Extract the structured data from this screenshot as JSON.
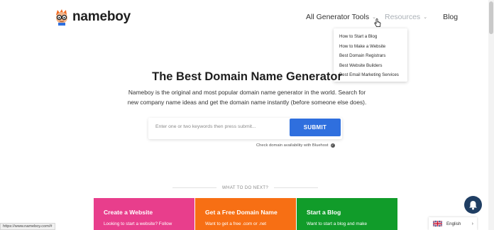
{
  "header": {
    "logo_text_bold": "name",
    "logo_text_rest": "boy",
    "nav": {
      "generator_tools": "All Generator Tools",
      "resources": "Resources",
      "blog": "Blog"
    }
  },
  "resources_dropdown": {
    "items": [
      "How to Start a Blog",
      "How to Make a Website",
      "Best Domain Registrars",
      "Best Website Builders",
      "Best Email Marketing Services"
    ]
  },
  "hero": {
    "title": "The Best Domain Name Generator",
    "subtitle": "Nameboy is the original and most popular domain name generator in the world. Search for new company name ideas and get the domain name instantly (before someone else does)."
  },
  "search": {
    "placeholder": "Enter one or two keywords then press submit...",
    "value": "",
    "submit_label": "SUBMIT",
    "availability_note": "Check domain availability with Bluehost"
  },
  "next_section": {
    "label": "WHAT TO DO NEXT?",
    "cards": [
      {
        "title": "Create a Website",
        "text": "Looking to start a website? Follow",
        "color": "#e83e8c"
      },
      {
        "title": "Get a Free Domain Name",
        "text": "Want to get a free .com or .net",
        "color": "#f76f14"
      },
      {
        "title": "Start a Blog",
        "text": "Want to start a blog and make",
        "color": "#119c2a"
      }
    ]
  },
  "language": {
    "selected": "English"
  },
  "status_url": "https://www.nameboy.com/#",
  "colors": {
    "accent": "#2f6fde",
    "chat": "#1f3e63"
  }
}
